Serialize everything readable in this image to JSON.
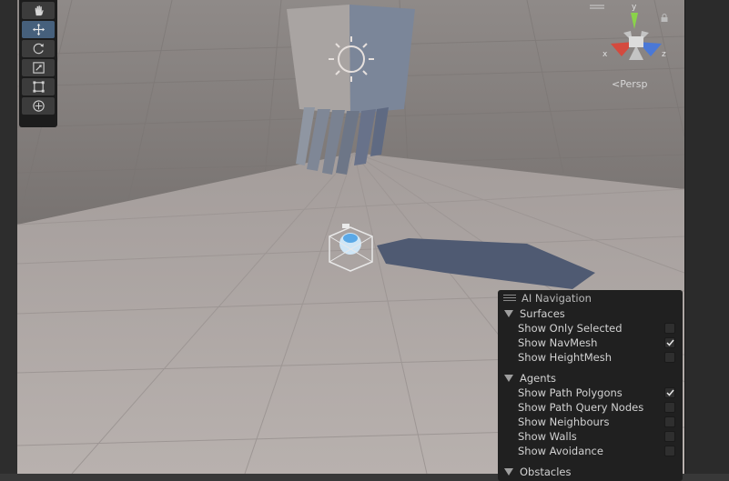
{
  "viewport": {
    "gizmo": {
      "y_label": "y",
      "x_label": "x",
      "z_label": "z"
    },
    "persp_label": "Persp",
    "tools": [
      {
        "name": "hand-tool",
        "icon": "hand-icon",
        "active": false
      },
      {
        "name": "move-tool",
        "icon": "move-icon",
        "active": true
      },
      {
        "name": "rotate-tool",
        "icon": "rotate-icon",
        "active": false
      },
      {
        "name": "scale-tool",
        "icon": "scale-icon",
        "active": false
      },
      {
        "name": "rect-tool",
        "icon": "rect-icon",
        "active": false
      },
      {
        "name": "transform-tool",
        "icon": "transform-icon",
        "active": false
      }
    ]
  },
  "overlay": {
    "title": "AI Navigation",
    "surfaces": {
      "label": "Surfaces",
      "items": [
        {
          "label": "Show Only Selected",
          "checked": false
        },
        {
          "label": "Show NavMesh",
          "checked": true
        },
        {
          "label": "Show HeightMesh",
          "checked": false
        }
      ]
    },
    "agents": {
      "label": "Agents",
      "items": [
        {
          "label": "Show Path Polygons",
          "checked": true
        },
        {
          "label": "Show Path Query Nodes",
          "checked": false
        },
        {
          "label": "Show Neighbours",
          "checked": false
        },
        {
          "label": "Show Walls",
          "checked": false
        },
        {
          "label": "Show Avoidance",
          "checked": false
        }
      ]
    },
    "obstacles": {
      "label": "Obstacles"
    }
  },
  "colors": {
    "active_tool": "#46607c",
    "gizmo_y": "#8ad34a",
    "gizmo_x": "#d44a3e",
    "gizmo_z": "#4a78d6"
  }
}
